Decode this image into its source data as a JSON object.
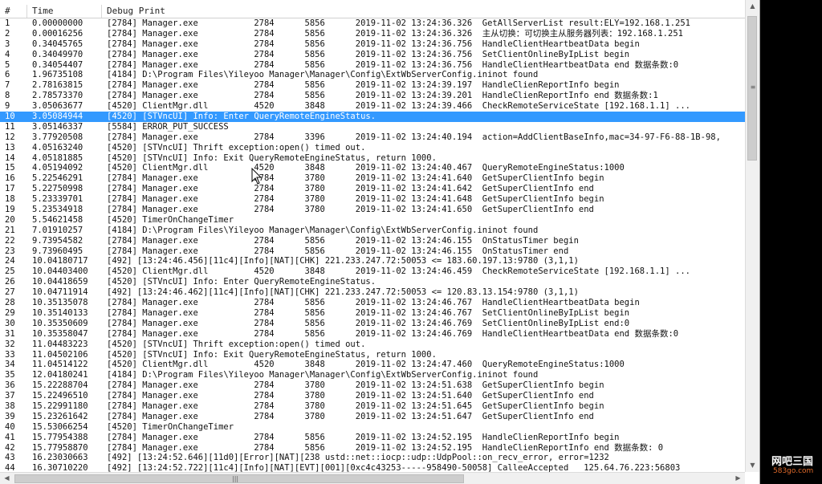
{
  "header": {
    "col_index": "#",
    "col_time": "Time",
    "col_debug": "Debug Print"
  },
  "selected_row": 10,
  "colors": {
    "selection": "#3399ff",
    "watermark_url": "#e06a2a"
  },
  "icons": {
    "cursor": "mouse-pointer-icon",
    "scroll_up": "chevron-up-icon",
    "scroll_down": "chevron-down-icon",
    "scroll_left": "chevron-left-icon",
    "scroll_right": "chevron-right-icon"
  },
  "rows": [
    {
      "idx": "1",
      "time": "0.00000000",
      "msg": "[2784] Manager.exe           2784      5856      2019-11-02 13:24:36.326  GetAllServerList result:ELY=192.168.1.251"
    },
    {
      "idx": "2",
      "time": "0.00016256",
      "msg": "[2784] Manager.exe           2784      5856      2019-11-02 13:24:36.326  主从切换：可切换主从服务器列表：192.168.1.251"
    },
    {
      "idx": "3",
      "time": "0.34045765",
      "msg": "[2784] Manager.exe           2784      5856      2019-11-02 13:24:36.756  HandleClientHeartbeatData begin"
    },
    {
      "idx": "4",
      "time": "0.34049970",
      "msg": "[2784] Manager.exe           2784      5856      2019-11-02 13:24:36.756  SetClientOnlineByIpList begin"
    },
    {
      "idx": "5",
      "time": "0.34054407",
      "msg": "[2784] Manager.exe           2784      5856      2019-11-02 13:24:36.756  HandleClientHeartbeatData end 数据条数:0"
    },
    {
      "idx": "6",
      "time": "1.96735108",
      "msg": "[4184] D:\\Program Files\\Yileyoo Manager\\Manager\\Config\\ExtWbServerConfig.ininot found"
    },
    {
      "idx": "7",
      "time": "2.78163815",
      "msg": "[2784] Manager.exe           2784      5856      2019-11-02 13:24:39.197  HandleClienReportInfo begin"
    },
    {
      "idx": "8",
      "time": "2.78573370",
      "msg": "[2784] Manager.exe           2784      5856      2019-11-02 13:24:39.201  HandleClienReportInfo end 数据条数:1"
    },
    {
      "idx": "9",
      "time": "3.05063677",
      "msg": "[4520] ClientMgr.dll         4520      3848      2019-11-02 13:24:39.466  CheckRemoteServiceState [192.168.1.1] ..."
    },
    {
      "idx": "10",
      "time": "3.05084944",
      "msg": "[4520] [STVncUI] Info: Enter QueryRemoteEngineStatus."
    },
    {
      "idx": "11",
      "time": "3.05146337",
      "msg": "[5584] ERROR_PUT_SUCCESS"
    },
    {
      "idx": "12",
      "time": "3.77920508",
      "msg": "[2784] Manager.exe           2784      3396      2019-11-02 13:24:40.194  action=AddClientBaseInfo,mac=34-97-F6-88-1B-98,"
    },
    {
      "idx": "13",
      "time": "4.05163240",
      "msg": "[4520] [STVncUI] Thrift exception:open() timed out."
    },
    {
      "idx": "14",
      "time": "4.05181885",
      "msg": "[4520] [STVncUI] Info: Exit QueryRemoteEngineStatus, return 1000."
    },
    {
      "idx": "15",
      "time": "4.05194092",
      "msg": "[4520] ClientMgr.dll         4520      3848      2019-11-02 13:24:40.467  QueryRemoteEngineStatus:1000"
    },
    {
      "idx": "16",
      "time": "5.22546291",
      "msg": "[2784] Manager.exe           2784      3780      2019-11-02 13:24:41.640  GetSuperClientInfo begin"
    },
    {
      "idx": "17",
      "time": "5.22750998",
      "msg": "[2784] Manager.exe           2784      3780      2019-11-02 13:24:41.642  GetSuperClientInfo end"
    },
    {
      "idx": "18",
      "time": "5.23339701",
      "msg": "[2784] Manager.exe           2784      3780      2019-11-02 13:24:41.648  GetSuperClientInfo begin"
    },
    {
      "idx": "19",
      "time": "5.23534918",
      "msg": "[2784] Manager.exe           2784      3780      2019-11-02 13:24:41.650  GetSuperClientInfo end"
    },
    {
      "idx": "20",
      "time": "5.54621458",
      "msg": "[4520] TimerOnChangeTimer"
    },
    {
      "idx": "21",
      "time": "7.01910257",
      "msg": "[4184] D:\\Program Files\\Yileyoo Manager\\Manager\\Config\\ExtWbServerConfig.ininot found"
    },
    {
      "idx": "22",
      "time": "9.73954582",
      "msg": "[2784] Manager.exe           2784      5856      2019-11-02 13:24:46.155  OnStatusTimer begin"
    },
    {
      "idx": "23",
      "time": "9.73960495",
      "msg": "[2784] Manager.exe           2784      5856      2019-11-02 13:24:46.155  OnStatusTimer end"
    },
    {
      "idx": "24",
      "time": "10.04180717",
      "msg": "[492] [13:24:46.456][11c4][Info][NAT][CHK] 221.233.247.72:50053 <= 183.60.197.13:9780 (3,1,1)"
    },
    {
      "idx": "25",
      "time": "10.04403400",
      "msg": "[4520] ClientMgr.dll         4520      3848      2019-11-02 13:24:46.459  CheckRemoteServiceState [192.168.1.1] ..."
    },
    {
      "idx": "26",
      "time": "10.04418659",
      "msg": "[4520] [STVncUI] Info: Enter QueryRemoteEngineStatus."
    },
    {
      "idx": "27",
      "time": "10.04711914",
      "msg": "[492] [13:24:46.462][11c4][Info][NAT][CHK] 221.233.247.72:50053 <= 120.83.13.154:9780 (3,1,1)"
    },
    {
      "idx": "28",
      "time": "10.35135078",
      "msg": "[2784] Manager.exe           2784      5856      2019-11-02 13:24:46.767  HandleClientHeartbeatData begin"
    },
    {
      "idx": "29",
      "time": "10.35140133",
      "msg": "[2784] Manager.exe           2784      5856      2019-11-02 13:24:46.767  SetClientOnlineByIpList begin"
    },
    {
      "idx": "30",
      "time": "10.35350609",
      "msg": "[2784] Manager.exe           2784      5856      2019-11-02 13:24:46.769  SetClientOnlineByIpList end:0"
    },
    {
      "idx": "31",
      "time": "10.35358047",
      "msg": "[2784] Manager.exe           2784      5856      2019-11-02 13:24:46.769  HandleClientHeartbeatData end 数据条数:0"
    },
    {
      "idx": "32",
      "time": "11.04483223",
      "msg": "[4520] [STVncUI] Thrift exception:open() timed out."
    },
    {
      "idx": "33",
      "time": "11.04502106",
      "msg": "[4520] [STVncUI] Info: Exit QueryRemoteEngineStatus, return 1000."
    },
    {
      "idx": "34",
      "time": "11.04514122",
      "msg": "[4520] ClientMgr.dll         4520      3848      2019-11-02 13:24:47.460  QueryRemoteEngineStatus:1000"
    },
    {
      "idx": "35",
      "time": "12.04180241",
      "msg": "[4184] D:\\Program Files\\Yileyoo Manager\\Manager\\Config\\ExtWbServerConfig.ininot found"
    },
    {
      "idx": "36",
      "time": "15.22288704",
      "msg": "[2784] Manager.exe           2784      3780      2019-11-02 13:24:51.638  GetSuperClientInfo begin"
    },
    {
      "idx": "37",
      "time": "15.22496510",
      "msg": "[2784] Manager.exe           2784      3780      2019-11-02 13:24:51.640  GetSuperClientInfo end"
    },
    {
      "idx": "38",
      "time": "15.22991180",
      "msg": "[2784] Manager.exe           2784      3780      2019-11-02 13:24:51.645  GetSuperClientInfo begin"
    },
    {
      "idx": "39",
      "time": "15.23261642",
      "msg": "[2784] Manager.exe           2784      3780      2019-11-02 13:24:51.647  GetSuperClientInfo end"
    },
    {
      "idx": "40",
      "time": "15.53066254",
      "msg": "[4520] TimerOnChangeTimer"
    },
    {
      "idx": "41",
      "time": "15.77954388",
      "msg": "[2784] Manager.exe           2784      5856      2019-11-02 13:24:52.195  HandleClienReportInfo begin"
    },
    {
      "idx": "42",
      "time": "15.77958870",
      "msg": "[2784] Manager.exe           2784      5856      2019-11-02 13:24:52.195  HandleClienReportInfo end 数据条数: 0"
    },
    {
      "idx": "43",
      "time": "16.23030663",
      "msg": "[492] [13:24:52.646][11d0][Error][NAT][238 ustd::net::iocp::udp::UdpPool::on_recv_error, error=1232"
    },
    {
      "idx": "44",
      "time": "16.30710220",
      "msg": "[492] [13:24:52.722][11c4][Info][NAT][EVT][001][0xc4c43253-----958490-50058] CalleeAccepted   125.64.76.223:56803"
    }
  ],
  "watermark": {
    "name": "网吧三国",
    "url": "583go.com"
  }
}
